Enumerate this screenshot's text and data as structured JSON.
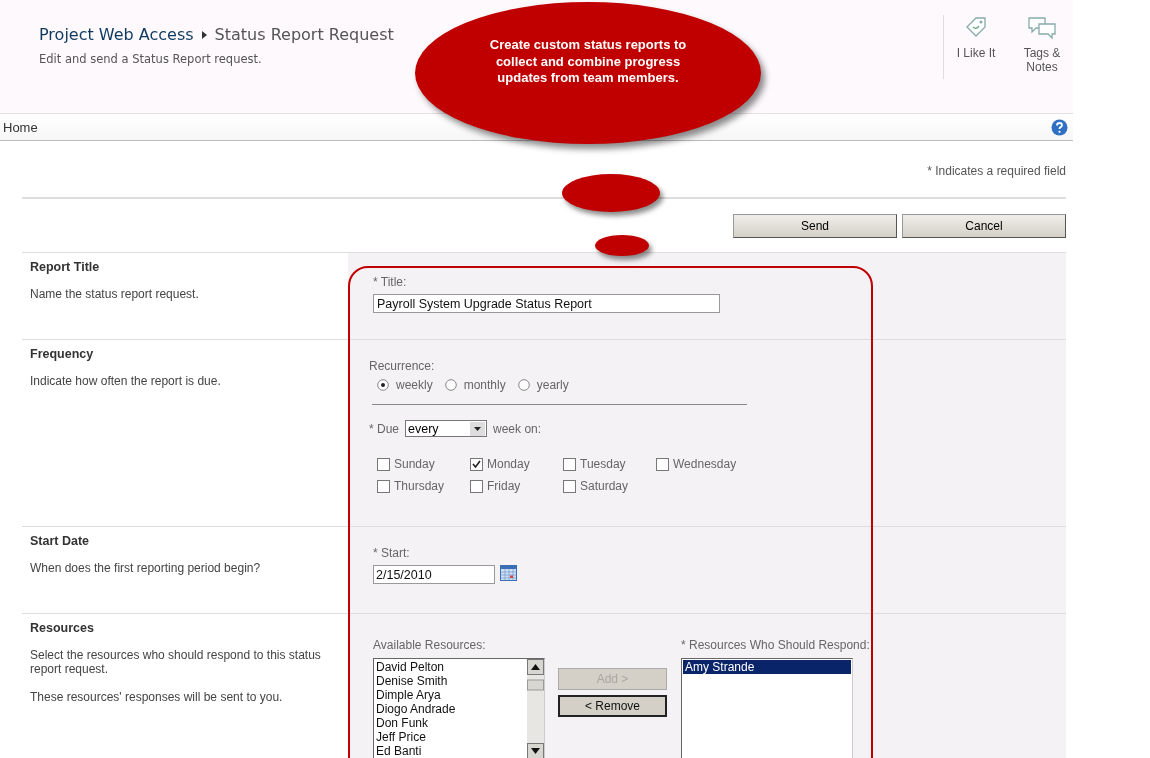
{
  "header": {
    "site": "Project Web Access",
    "page": "Status Report Request",
    "subtitle": "Edit and send a Status Report request.",
    "actions": [
      {
        "kind": "like",
        "label": "I Like It"
      },
      {
        "kind": "tags",
        "label": "Tags &\nNotes"
      }
    ]
  },
  "nav": {
    "home": "Home"
  },
  "callout": {
    "text": "Create  custom status reports to collect and combine progress updates from team members."
  },
  "required_note": "* Indicates a required field",
  "buttons": [
    {
      "label": "Send"
    },
    {
      "label": "Cancel"
    }
  ],
  "sections": [
    {
      "kind": "title",
      "title": "Report Title",
      "descriptions": [
        "Name the status report request."
      ]
    },
    {
      "kind": "frequency",
      "title": "Frequency",
      "descriptions": [
        "Indicate how often the report is due."
      ]
    },
    {
      "kind": "start",
      "title": "Start Date",
      "descriptions": [
        "When does the first reporting period begin?"
      ]
    },
    {
      "kind": "resources",
      "title": "Resources",
      "descriptions": [
        "Select the resources who should respond to this status report request.",
        "These resources' responses will be sent to you."
      ]
    }
  ],
  "form": {
    "title_field": {
      "label": "* Title:",
      "value": "Payroll System Upgrade Status Report"
    },
    "recurrence": {
      "label": "Recurrence:",
      "options": [
        {
          "label": "weekly",
          "selected": true
        },
        {
          "label": "monthly",
          "selected": false
        },
        {
          "label": "yearly",
          "selected": false
        }
      ]
    },
    "due": {
      "label": "* Due",
      "value": "every",
      "suffix": "week on:"
    },
    "days": [
      {
        "label": "Sunday",
        "checked": false
      },
      {
        "label": "Monday",
        "checked": true
      },
      {
        "label": "Tuesday",
        "checked": false
      },
      {
        "label": "Wednesday",
        "checked": false
      },
      {
        "label": "Thursday",
        "checked": false
      },
      {
        "label": "Friday",
        "checked": false
      },
      {
        "label": "Saturday",
        "checked": false
      }
    ],
    "start": {
      "label": "* Start:",
      "value": "2/15/2010"
    },
    "available": {
      "label": "Available Resources:",
      "items": [
        "David Pelton",
        "Denise Smith",
        "Dimple Arya",
        "Diogo Andrade",
        "Don Funk",
        "Jeff Price",
        "Ed Banti"
      ]
    },
    "move_buttons": [
      {
        "label": "Add >",
        "disabled": true
      },
      {
        "label": "< Remove",
        "disabled": false
      }
    ],
    "respond": {
      "label": "* Resources Who Should Respond:",
      "items": [
        {
          "label": "Amy Strande",
          "selected": true
        }
      ]
    }
  }
}
